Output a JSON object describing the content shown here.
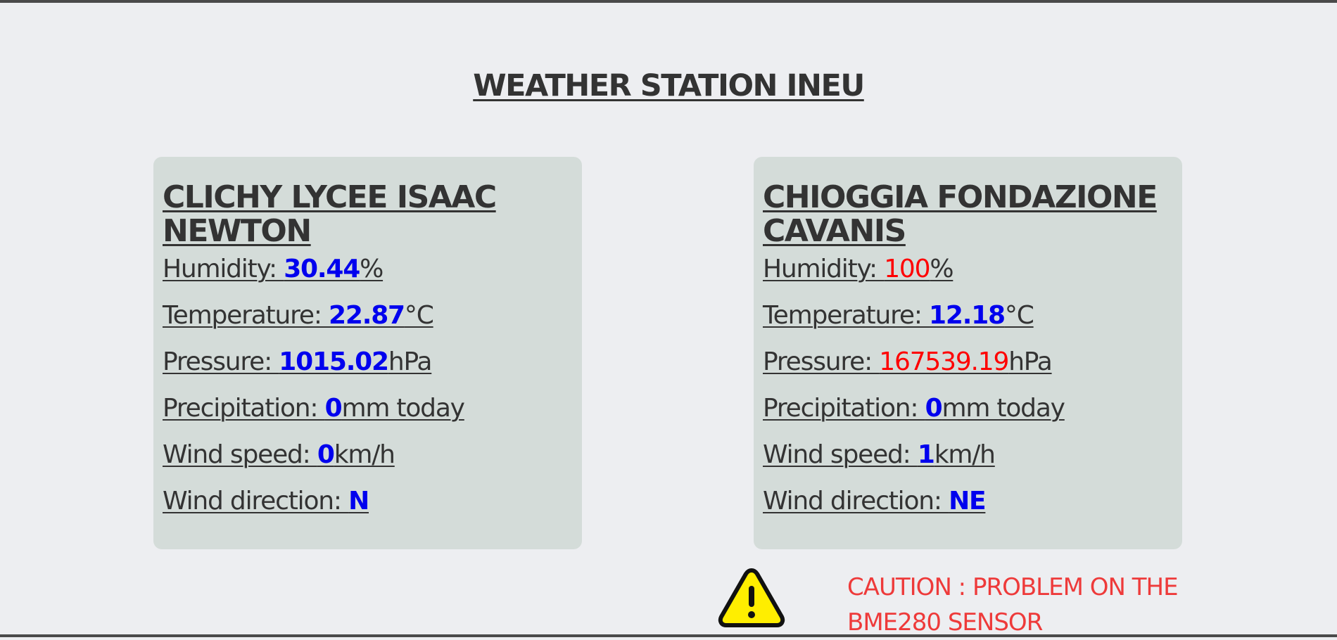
{
  "page": {
    "title": "WEATHER STATION INEU"
  },
  "stations": [
    {
      "name": "CLICHY LYCEE ISAAC NEWTON",
      "humidity": {
        "label": "Humidity: ",
        "value": "30.44",
        "unit": "%"
      },
      "temperature": {
        "label": "Temperature: ",
        "value": "22.87",
        "unit": "°C"
      },
      "pressure": {
        "label": "Pressure: ",
        "value": "1015.02",
        "unit": "hPa"
      },
      "precipitation": {
        "label": "Precipitation: ",
        "value": "0",
        "unit": "mm today"
      },
      "wind_speed": {
        "label": "Wind speed: ",
        "value": "0",
        "unit": "km/h"
      },
      "wind_direction": {
        "label": "Wind direction: ",
        "value": "N",
        "unit": ""
      }
    },
    {
      "name": "CHIOGGIA FONDAZIONE CAVANIS",
      "humidity": {
        "label": "Humidity: ",
        "value": "100",
        "unit": "%"
      },
      "temperature": {
        "label": "Temperature: ",
        "value": "12.18",
        "unit": "°C"
      },
      "pressure": {
        "label": "Pressure: ",
        "value": "167539.19",
        "unit": "hPa"
      },
      "precipitation": {
        "label": "Precipitation: ",
        "value": "0",
        "unit": "mm today"
      },
      "wind_speed": {
        "label": "Wind speed: ",
        "value": "1",
        "unit": "km/h"
      },
      "wind_direction": {
        "label": "Wind direction: ",
        "value": "NE",
        "unit": ""
      }
    }
  ],
  "alert": {
    "icon": "warning-triangle-icon",
    "text": "CAUTION : PROBLEM ON THE BME280 SENSOR"
  },
  "colors": {
    "value_normal": "#0000ee",
    "value_error": "#ff0000",
    "alert_text": "#ee3a3a",
    "card_background": "#d4dcd9",
    "page_background": "#edeef1"
  }
}
